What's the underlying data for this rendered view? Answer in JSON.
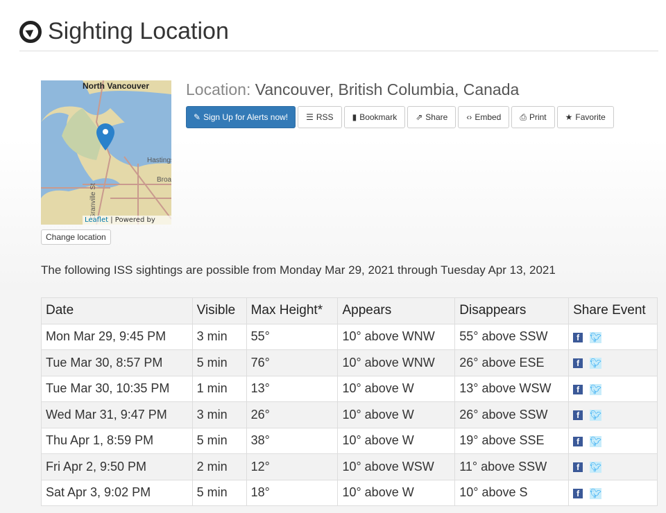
{
  "page": {
    "title": "Sighting Location",
    "title_icon": "compass-icon"
  },
  "map": {
    "label_north": "North Vancouver",
    "label_hastings": "Hastings",
    "label_broadway": "Broadway",
    "label_street": "Granville St",
    "attribution_link": "Leaflet",
    "attribution_text": " | Powered by",
    "change_location": "Change location"
  },
  "location": {
    "prefix": "Location:",
    "name": " Vancouver, British Columbia, Canada"
  },
  "actions": [
    {
      "label": "Sign Up for Alerts now!",
      "icon": "edit-icon",
      "glyph": "✎"
    },
    {
      "label": "RSS",
      "icon": "rss-icon",
      "glyph": "☰"
    },
    {
      "label": "Bookmark",
      "icon": "bookmark-icon",
      "glyph": "▮"
    },
    {
      "label": "Share",
      "icon": "share-icon",
      "glyph": "⇗"
    },
    {
      "label": "Embed",
      "icon": "code-icon",
      "glyph": "‹›"
    },
    {
      "label": "Print",
      "icon": "print-icon",
      "glyph": "⎙"
    },
    {
      "label": "Favorite",
      "icon": "star-icon",
      "glyph": "★"
    }
  ],
  "intro": "The following ISS sightings are possible from Monday Mar 29, 2021 through Tuesday Apr 13, 2021",
  "table": {
    "headers": [
      "Date",
      "Visible",
      "Max Height*",
      "Appears",
      "Disappears",
      "Share Event"
    ],
    "rows": [
      [
        "Mon Mar 29, 9:45 PM",
        "3 min",
        "55°",
        "10° above WNW",
        "55° above SSW"
      ],
      [
        "Tue Mar 30, 8:57 PM",
        "5 min",
        "76°",
        "10° above WNW",
        "26° above ESE"
      ],
      [
        "Tue Mar 30, 10:35 PM",
        "1 min",
        "13°",
        "10° above W",
        "13° above WSW"
      ],
      [
        "Wed Mar 31, 9:47 PM",
        "3 min",
        "26°",
        "10° above W",
        "26° above SSW"
      ],
      [
        "Thu Apr 1, 8:59 PM",
        "5 min",
        "38°",
        "10° above W",
        "19° above SSE"
      ],
      [
        "Fri Apr 2, 9:50 PM",
        "2 min",
        "12°",
        "10° above WSW",
        "11° above SSW"
      ],
      [
        "Sat Apr 3, 9:02 PM",
        "5 min",
        "18°",
        "10° above W",
        "10° above S"
      ]
    ]
  },
  "colors": {
    "primary": "#337ab7",
    "facebook": "#3b5998",
    "twitter": "#1da1f2"
  }
}
